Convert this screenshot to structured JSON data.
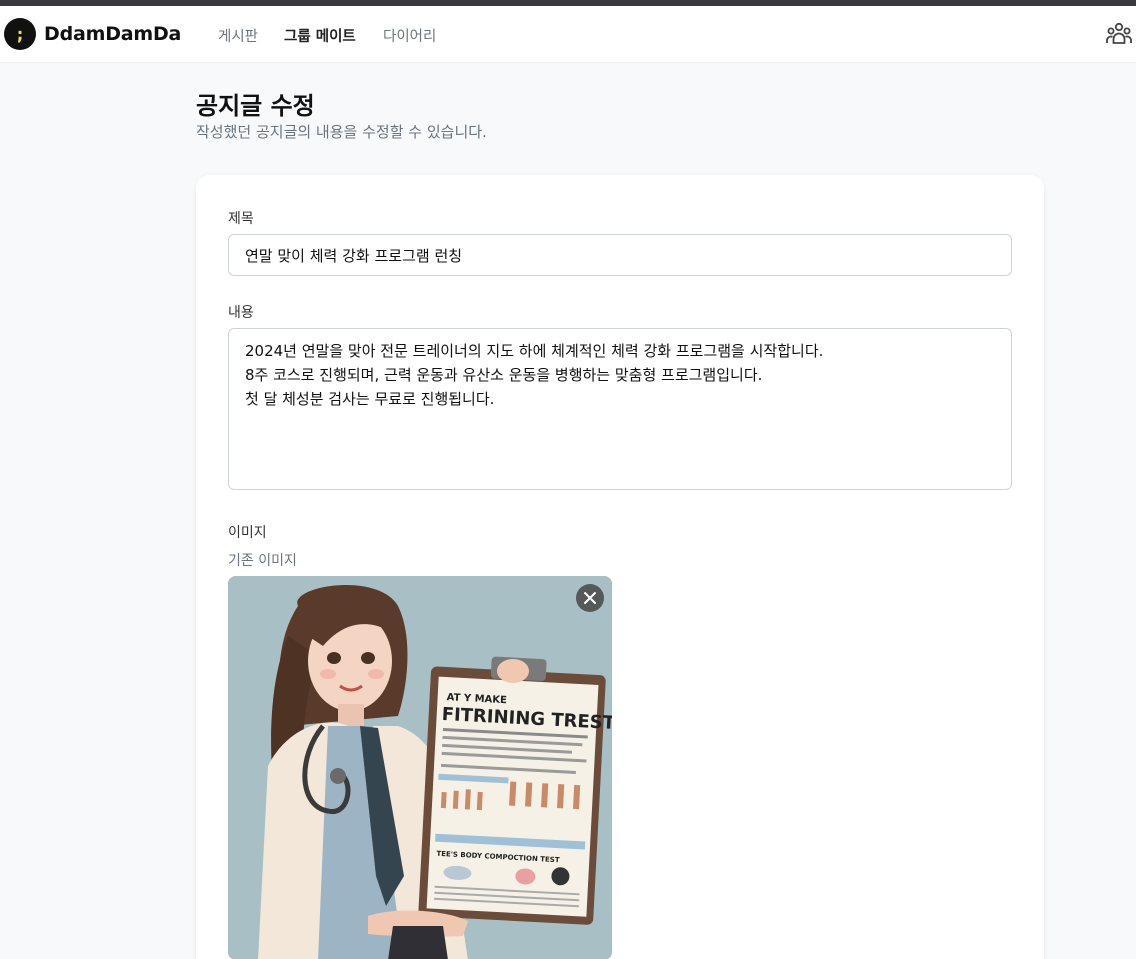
{
  "app": {
    "brand": "DdamDamDa",
    "logo_glyph": ";"
  },
  "nav": {
    "items": [
      {
        "label": "게시판",
        "active": false
      },
      {
        "label": "그룹 메이트",
        "active": true
      },
      {
        "label": "다이어리",
        "active": false
      }
    ],
    "right_icon": "users-group-icon"
  },
  "header": {
    "title": "공지글 수정",
    "subtitle": "작성했던 공지글의 내용을 수정할 수 있습니다."
  },
  "form": {
    "title_label": "제목",
    "title_value": "연말 맞이 체력 강화 프로그램 런칭",
    "content_label": "내용",
    "content_value": "2024년 연말을 맞아 전문 트레이너의 지도 하에 체계적인 체력 강화 프로그램을 시작합니다.\n8주 코스로 진행되며, 근력 운동과 유산소 운동을 병행하는 맞춤형 프로그램입니다.\n첫 달 체성분 검사는 무료로 진행됩니다.",
    "image_label": "이미지",
    "existing_image_label": "기존 이미지",
    "image_clipboard_heading": "FITRINING TREST:",
    "image_clipboard_kicker": "AT Y MAKE",
    "image_clipboard_section": "TEE'S BODY COMPOCTION TEST",
    "remove_icon": "close-icon"
  },
  "colors": {
    "accent_logo": "#e8e43a",
    "nav_active": "#222222",
    "nav_inactive": "#6c757d",
    "page_bg": "#f8f9fa"
  }
}
